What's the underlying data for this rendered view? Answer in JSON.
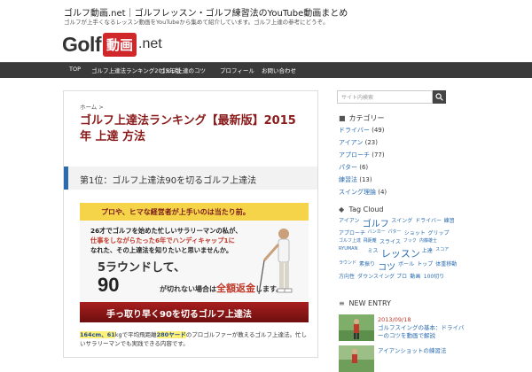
{
  "header": {
    "site_title": "ゴルフ動画.net｜ゴルフレッスン・ゴルフ練習法のYouTube動画まとめ",
    "site_sub": "ゴルフが上手くなるレッスン動画をYouTubeから集めて紹介しています。ゴルフ上達の参考にどうぞ。",
    "logo_golf": "Golf",
    "logo_mid": "動画",
    "logo_net": ".net"
  },
  "nav": {
    "items": [
      "TOP",
      "ゴルフ上達法ランキング2015年版",
      "ゴルフ上達のコツ",
      "プロフィール",
      "お問い合わせ"
    ]
  },
  "main": {
    "breadcrumb": "ホーム >",
    "title": "ゴルフ上達法ランキング【最新版】2015年 上達 方法",
    "section_heading": "第1位：ゴルフ上達法90を切るゴルフ上達法",
    "banner": {
      "top": "プロや、ヒマな経営者が上手いのは当たり前。",
      "line1": "26才でゴルフを始めた忙しいサラリーマンの私が、",
      "line2": "仕事をしながらたった6年でハンディキャップ1に",
      "line3": "なれた、その上達法を知りたいと思いませんか。",
      "rounds": "5ラウンドして、",
      "ninety": "90",
      "refund_pre": "が切れない場合は",
      "refund": "全額返金",
      "refund_post": "します。",
      "cta": "手っ取り早く90を切るゴルフ上達法"
    },
    "body_hl1": "164cm、61",
    "body_mid": "kgで平均飛距離",
    "body_hl2": "280ヤード",
    "body_rest": "のプロゴルファーが教えるゴルフ上達法。忙しいサラリーマンでも実践できる内容です。"
  },
  "sidebar": {
    "search_placeholder": "サイト内検索",
    "categories_heading": "カテゴリー",
    "categories": [
      {
        "name": "ドライバー",
        "count": "(49)"
      },
      {
        "name": "アイアン",
        "count": "(23)"
      },
      {
        "name": "アプローチ",
        "count": "(77)"
      },
      {
        "name": "パター",
        "count": "(6)"
      },
      {
        "name": "練習法",
        "count": "(13)"
      },
      {
        "name": "スイング理論",
        "count": "(4)"
      }
    ],
    "tag_heading": "Tag Cloud",
    "tags": [
      "アイアン",
      "ゴルフ",
      "スイング",
      "ドライバー",
      "練習",
      "アプローチ",
      "バンカー",
      "パター",
      "ショット",
      "グリップ",
      "ゴルフ上達",
      "飛距離",
      "スライス",
      "フック",
      "内藤雄士",
      "RYUMAN",
      "ミス",
      "レッスン",
      "上達",
      "スコア",
      "ラウンド",
      "素振り",
      "コツ",
      "ボール",
      "トップ",
      "体重移動",
      "方向性",
      "ダウンスイング",
      "プロ",
      "動画",
      "100切り",
      "90切り",
      "テークバック",
      "体幹",
      "腰"
    ],
    "new_entry_heading": "NEW ENTRY",
    "entries": [
      {
        "date": "2013/09/18",
        "title": "ゴルフスイングの基本：ドライバーのコツを動画で解説"
      },
      {
        "date": "",
        "title": "アイアンショットの練習法"
      }
    ]
  }
}
